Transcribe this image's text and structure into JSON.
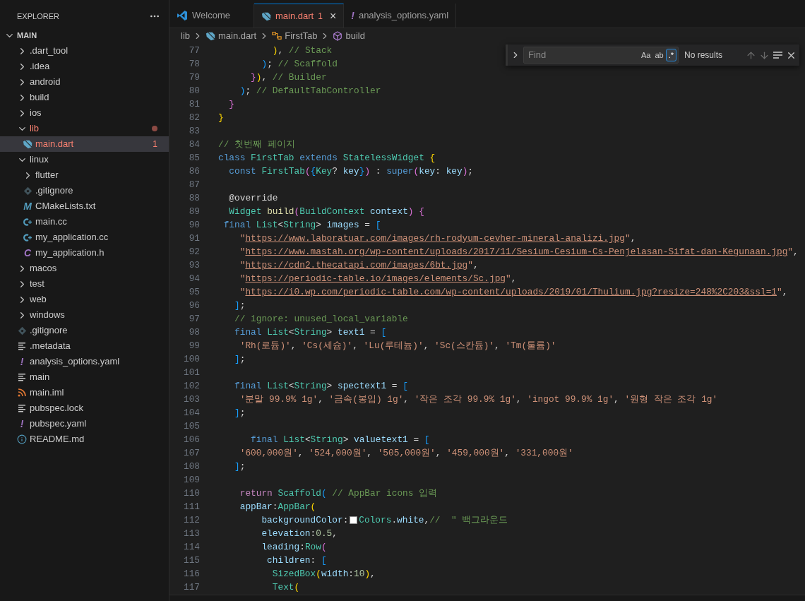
{
  "sidebar": {
    "title": "EXPLORER",
    "tree": [
      {
        "name": "MAIN",
        "kind": "folder",
        "expanded": true,
        "selected": false,
        "children": [
          {
            "name": ".dart_tool",
            "kind": "folder",
            "expanded": false,
            "selected": false
          },
          {
            "name": ".idea",
            "kind": "folder",
            "expanded": false,
            "selected": false
          },
          {
            "name": "android",
            "kind": "folder",
            "expanded": false,
            "selected": false
          },
          {
            "name": "build",
            "kind": "folder",
            "expanded": false,
            "selected": false
          },
          {
            "name": "ios",
            "kind": "folder",
            "expanded": false,
            "selected": false
          },
          {
            "name": "lib",
            "kind": "folder",
            "expanded": true,
            "selected": false,
            "error": true,
            "dot": true,
            "children": [
              {
                "name": "main.dart",
                "kind": "dart",
                "selected": true,
                "error": true,
                "badge": "1"
              }
            ]
          },
          {
            "name": "linux",
            "kind": "folder",
            "expanded": true,
            "selected": false,
            "children": [
              {
                "name": "flutter",
                "kind": "folder",
                "expanded": false,
                "selected": false
              },
              {
                "name": ".gitignore",
                "kind": "git",
                "selected": false
              },
              {
                "name": "CMakeLists.txt",
                "kind": "glyph",
                "glyph": "M",
                "color": "#519aba",
                "selected": false
              },
              {
                "name": "main.cc",
                "kind": "cpp",
                "selected": false
              },
              {
                "name": "my_application.cc",
                "kind": "cpp",
                "selected": false
              },
              {
                "name": "my_application.h",
                "kind": "glyph",
                "glyph": "C",
                "color": "#a074c4",
                "selected": false
              }
            ]
          },
          {
            "name": "macos",
            "kind": "folder",
            "expanded": false,
            "selected": false
          },
          {
            "name": "test",
            "kind": "folder",
            "expanded": false,
            "selected": false
          },
          {
            "name": "web",
            "kind": "folder",
            "expanded": false,
            "selected": false
          },
          {
            "name": "windows",
            "kind": "folder",
            "expanded": false,
            "selected": false
          },
          {
            "name": ".gitignore",
            "kind": "git",
            "selected": false
          },
          {
            "name": ".metadata",
            "kind": "lines",
            "selected": false
          },
          {
            "name": "analysis_options.yaml",
            "kind": "glyph",
            "glyph": "!",
            "color": "#a074c4",
            "selected": false
          },
          {
            "name": "main",
            "kind": "lines",
            "selected": false
          },
          {
            "name": "main.iml",
            "kind": "rss",
            "selected": false
          },
          {
            "name": "pubspec.lock",
            "kind": "lines",
            "selected": false
          },
          {
            "name": "pubspec.yaml",
            "kind": "glyph",
            "glyph": "!",
            "color": "#a074c4",
            "selected": false
          },
          {
            "name": "README.md",
            "kind": "info",
            "selected": false
          }
        ]
      }
    ]
  },
  "tabs": [
    {
      "label": "Welcome",
      "kind": "vscode",
      "selected": false,
      "error": false
    },
    {
      "label": "main.dart",
      "kind": "dart",
      "selected": true,
      "error": true,
      "badge": "1",
      "close": "×"
    },
    {
      "label": "analysis_options.yaml",
      "kind": "glyph",
      "glyph": "!",
      "selected": false,
      "error": false
    }
  ],
  "breadcrumb": [
    {
      "label": "lib",
      "kind": "none"
    },
    {
      "label": "main.dart",
      "kind": "dart"
    },
    {
      "label": "FirstTab",
      "kind": "class"
    },
    {
      "label": "build",
      "kind": "method"
    }
  ],
  "find": {
    "placeholder": "Find",
    "toggles": [
      {
        "label": "Aa",
        "on": false
      },
      {
        "label": "ab",
        "on": false
      },
      {
        "label": ".*",
        "on": true
      }
    ],
    "result": "No results"
  },
  "code": [
    {
      "n": "77",
      "tokens": [
        {
          "kind": "b1",
          "text": "          )"
        },
        {
          "kind": "pl",
          "text": ", "
        },
        {
          "kind": "com",
          "text": "// Stack"
        }
      ]
    },
    {
      "n": "78",
      "tokens": [
        {
          "kind": "b3",
          "text": "        )"
        },
        {
          "kind": "pl",
          "text": "; "
        },
        {
          "kind": "com",
          "text": "// Scaffold"
        }
      ]
    },
    {
      "n": "79",
      "tokens": [
        {
          "kind": "b2",
          "text": "      }"
        },
        {
          "kind": "b1",
          "text": ")"
        },
        {
          "kind": "pl",
          "text": ", "
        },
        {
          "kind": "com",
          "text": "// Builder"
        }
      ]
    },
    {
      "n": "80",
      "tokens": [
        {
          "kind": "b3",
          "text": "    )"
        },
        {
          "kind": "pl",
          "text": "; "
        },
        {
          "kind": "com",
          "text": "// DefaultTabController"
        }
      ]
    },
    {
      "n": "81",
      "tokens": [
        {
          "kind": "b2",
          "text": "  }"
        }
      ]
    },
    {
      "n": "82",
      "tokens": [
        {
          "kind": "b1",
          "text": "}"
        }
      ]
    },
    {
      "n": "83"
    },
    {
      "n": "84",
      "tokens": [
        {
          "kind": "com",
          "text": "// 첫번째 페이지"
        }
      ]
    },
    {
      "n": "85",
      "tokens": [
        {
          "kind": "kw",
          "text": "class "
        },
        {
          "kind": "ty",
          "text": "FirstTab "
        },
        {
          "kind": "kw",
          "text": "extends "
        },
        {
          "kind": "ty",
          "text": "StatelessWidget "
        },
        {
          "kind": "b1",
          "text": "{"
        }
      ]
    },
    {
      "n": "86",
      "tokens": [
        {
          "kind": "kw",
          "text": "  const "
        },
        {
          "kind": "ty",
          "text": "FirstTab"
        },
        {
          "kind": "b2",
          "text": "("
        },
        {
          "kind": "b3",
          "text": "{"
        },
        {
          "kind": "ty",
          "text": "Key"
        },
        {
          "kind": "pl",
          "text": "? "
        },
        {
          "kind": "var",
          "text": "key"
        },
        {
          "kind": "b3",
          "text": "}"
        },
        {
          "kind": "b2",
          "text": ")"
        },
        {
          "kind": "pl",
          "text": " : "
        },
        {
          "kind": "kw",
          "text": "super"
        },
        {
          "kind": "b2",
          "text": "("
        },
        {
          "kind": "var",
          "text": "key"
        },
        {
          "kind": "pl",
          "text": ": "
        },
        {
          "kind": "var",
          "text": "key"
        },
        {
          "kind": "b2",
          "text": ")"
        },
        {
          "kind": "pl",
          "text": ";"
        }
      ]
    },
    {
      "n": "87"
    },
    {
      "n": "88",
      "tokens": [
        {
          "kind": "pl",
          "text": "  @override"
        }
      ]
    },
    {
      "n": "89",
      "tokens": [
        {
          "kind": "ty",
          "text": "  Widget "
        },
        {
          "kind": "fn",
          "text": "build"
        },
        {
          "kind": "b2",
          "text": "("
        },
        {
          "kind": "ty",
          "text": "BuildContext "
        },
        {
          "kind": "var",
          "text": "context"
        },
        {
          "kind": "b2",
          "text": ") {"
        }
      ]
    },
    {
      "n": "90",
      "tokens": [
        {
          "kind": "kw",
          "text": " final "
        },
        {
          "kind": "ty",
          "text": "List"
        },
        {
          "kind": "pl",
          "text": "<"
        },
        {
          "kind": "ty",
          "text": "String"
        },
        {
          "kind": "pl",
          "text": "> "
        },
        {
          "kind": "var",
          "text": "images"
        },
        {
          "kind": "pl",
          "text": " = "
        },
        {
          "kind": "b3",
          "text": "["
        }
      ]
    },
    {
      "n": "91",
      "tokens": [
        {
          "kind": "str",
          "text": "    \""
        },
        {
          "kind": "url",
          "text": "https://www.laboratuar.com/images/rh-rodyum-cevher-mineral-analizi.jpg"
        },
        {
          "kind": "str",
          "text": "\""
        },
        {
          "kind": "pl",
          "text": ","
        }
      ]
    },
    {
      "n": "92",
      "tokens": [
        {
          "kind": "str",
          "text": "    \""
        },
        {
          "kind": "url",
          "text": "https://www.mastah.org/wp-content/uploads/2017/11/Sesium-Cesium-Cs-Penjelasan-Sifat-dan-Kegunaan.jpg"
        },
        {
          "kind": "str",
          "text": "\""
        },
        {
          "kind": "pl",
          "text": ","
        }
      ]
    },
    {
      "n": "93",
      "tokens": [
        {
          "kind": "str",
          "text": "    \""
        },
        {
          "kind": "url",
          "text": "https://cdn2.thecatapi.com/images/6bt.jpg"
        },
        {
          "kind": "str",
          "text": "\""
        },
        {
          "kind": "pl",
          "text": ","
        }
      ]
    },
    {
      "n": "94",
      "tokens": [
        {
          "kind": "str",
          "text": "    \""
        },
        {
          "kind": "url",
          "text": "https://periodic-table.io/images/elements/Sc.jpg"
        },
        {
          "kind": "str",
          "text": "\""
        },
        {
          "kind": "pl",
          "text": ","
        }
      ]
    },
    {
      "n": "95",
      "tokens": [
        {
          "kind": "str",
          "text": "    \""
        },
        {
          "kind": "url",
          "text": "https://i0.wp.com/periodic-table.com/wp-content/uploads/2019/01/Thulium.jpg?resize=248%2C203&ssl=1"
        },
        {
          "kind": "str",
          "text": "\""
        },
        {
          "kind": "pl",
          "text": ","
        }
      ]
    },
    {
      "n": "96",
      "tokens": [
        {
          "kind": "b3",
          "text": "   ]"
        },
        {
          "kind": "pl",
          "text": ";"
        }
      ]
    },
    {
      "n": "97",
      "tokens": [
        {
          "kind": "com",
          "text": "   // ignore: unused_local_variable"
        }
      ]
    },
    {
      "n": "98",
      "tokens": [
        {
          "kind": "kw",
          "text": "   final "
        },
        {
          "kind": "ty",
          "text": "List"
        },
        {
          "kind": "pl",
          "text": "<"
        },
        {
          "kind": "ty",
          "text": "String"
        },
        {
          "kind": "pl",
          "text": "> "
        },
        {
          "kind": "var",
          "text": "text1"
        },
        {
          "kind": "pl",
          "text": " = "
        },
        {
          "kind": "b3",
          "text": "["
        }
      ]
    },
    {
      "n": "99",
      "tokens": [
        {
          "kind": "str",
          "text": "    'Rh(로듐)'"
        },
        {
          "kind": "pl",
          "text": ", "
        },
        {
          "kind": "str",
          "text": "'Cs(세슘)'"
        },
        {
          "kind": "pl",
          "text": ", "
        },
        {
          "kind": "str",
          "text": "'Lu(루테늄)'"
        },
        {
          "kind": "pl",
          "text": ", "
        },
        {
          "kind": "str",
          "text": "'Sc(스칸듐)'"
        },
        {
          "kind": "pl",
          "text": ", "
        },
        {
          "kind": "str",
          "text": "'Tm(툴륨)'"
        }
      ]
    },
    {
      "n": "100",
      "tokens": [
        {
          "kind": "b3",
          "text": "   ]"
        },
        {
          "kind": "pl",
          "text": ";"
        }
      ]
    },
    {
      "n": "101"
    },
    {
      "n": "102",
      "tokens": [
        {
          "kind": "kw",
          "text": "   final "
        },
        {
          "kind": "ty",
          "text": "List"
        },
        {
          "kind": "pl",
          "text": "<"
        },
        {
          "kind": "ty",
          "text": "String"
        },
        {
          "kind": "pl",
          "text": "> "
        },
        {
          "kind": "var",
          "text": "spectext1"
        },
        {
          "kind": "pl",
          "text": " = "
        },
        {
          "kind": "b3",
          "text": "["
        }
      ]
    },
    {
      "n": "103",
      "tokens": [
        {
          "kind": "str",
          "text": "    '분말 99.9% 1g'"
        },
        {
          "kind": "pl",
          "text": ", "
        },
        {
          "kind": "str",
          "text": "'금속(봉입) 1g'"
        },
        {
          "kind": "pl",
          "text": ", "
        },
        {
          "kind": "str",
          "text": "'작은 조각 99.9% 1g'"
        },
        {
          "kind": "pl",
          "text": ", "
        },
        {
          "kind": "str",
          "text": "'ingot 99.9% 1g'"
        },
        {
          "kind": "pl",
          "text": ", "
        },
        {
          "kind": "str",
          "text": "'원형 작은 조각 1g'"
        }
      ]
    },
    {
      "n": "104",
      "tokens": [
        {
          "kind": "b3",
          "text": "   ]"
        },
        {
          "kind": "pl",
          "text": ";"
        }
      ]
    },
    {
      "n": "105"
    },
    {
      "n": "106",
      "tokens": [
        {
          "kind": "kw",
          "text": "      final "
        },
        {
          "kind": "ty",
          "text": "List"
        },
        {
          "kind": "pl",
          "text": "<"
        },
        {
          "kind": "ty",
          "text": "String"
        },
        {
          "kind": "pl",
          "text": "> "
        },
        {
          "kind": "var",
          "text": "valuetext1"
        },
        {
          "kind": "pl",
          "text": " = "
        },
        {
          "kind": "b3",
          "text": "["
        }
      ]
    },
    {
      "n": "107",
      "tokens": [
        {
          "kind": "str",
          "text": "    '600,000원'"
        },
        {
          "kind": "pl",
          "text": ", "
        },
        {
          "kind": "str",
          "text": "'524,000원'"
        },
        {
          "kind": "pl",
          "text": ", "
        },
        {
          "kind": "str",
          "text": "'505,000원'"
        },
        {
          "kind": "pl",
          "text": ", "
        },
        {
          "kind": "str",
          "text": "'459,000원'"
        },
        {
          "kind": "pl",
          "text": ", "
        },
        {
          "kind": "str",
          "text": "'331,000원'"
        }
      ]
    },
    {
      "n": "108",
      "tokens": [
        {
          "kind": "b3",
          "text": "   ]"
        },
        {
          "kind": "pl",
          "text": ";"
        }
      ]
    },
    {
      "n": "109"
    },
    {
      "n": "110",
      "tokens": [
        {
          "kind": "ctl",
          "text": "    return "
        },
        {
          "kind": "ty",
          "text": "Scaffold"
        },
        {
          "kind": "b3",
          "text": "( "
        },
        {
          "kind": "com",
          "text": "// AppBar icons 입력"
        }
      ]
    },
    {
      "n": "111",
      "tokens": [
        {
          "kind": "var",
          "text": "    appBar"
        },
        {
          "kind": "pl",
          "text": ":"
        },
        {
          "kind": "ty",
          "text": "AppBar"
        },
        {
          "kind": "b1",
          "text": "("
        }
      ]
    },
    {
      "n": "112",
      "tokens": [
        {
          "kind": "var",
          "text": "        backgroundColor"
        },
        {
          "kind": "pl",
          "text": ":"
        },
        {
          "kind": "swatch",
          "color": "#ffffff"
        },
        {
          "kind": "ty",
          "text": "Colors"
        },
        {
          "kind": "pl",
          "text": "."
        },
        {
          "kind": "var",
          "text": "white"
        },
        {
          "kind": "pl",
          "text": ","
        },
        {
          "kind": "com",
          "text": "//  \" 백그라운드"
        }
      ]
    },
    {
      "n": "113",
      "tokens": [
        {
          "kind": "var",
          "text": "        elevation"
        },
        {
          "kind": "pl",
          "text": ":"
        },
        {
          "kind": "num",
          "text": "0.5"
        },
        {
          "kind": "pl",
          "text": ","
        }
      ]
    },
    {
      "n": "114",
      "tokens": [
        {
          "kind": "var",
          "text": "        leading"
        },
        {
          "kind": "pl",
          "text": ":"
        },
        {
          "kind": "ty",
          "text": "Row"
        },
        {
          "kind": "b2",
          "text": "("
        }
      ]
    },
    {
      "n": "115",
      "tokens": [
        {
          "kind": "var",
          "text": "         children"
        },
        {
          "kind": "pl",
          "text": ": "
        },
        {
          "kind": "b3",
          "text": "["
        }
      ]
    },
    {
      "n": "116",
      "tokens": [
        {
          "kind": "ty",
          "text": "          SizedBox"
        },
        {
          "kind": "b1",
          "text": "("
        },
        {
          "kind": "var",
          "text": "width"
        },
        {
          "kind": "pl",
          "text": ":"
        },
        {
          "kind": "num",
          "text": "10"
        },
        {
          "kind": "b1",
          "text": ")"
        },
        {
          "kind": "pl",
          "text": ","
        }
      ]
    },
    {
      "n": "117",
      "tokens": [
        {
          "kind": "ty",
          "text": "          Text"
        },
        {
          "kind": "b1",
          "text": "("
        }
      ]
    }
  ]
}
